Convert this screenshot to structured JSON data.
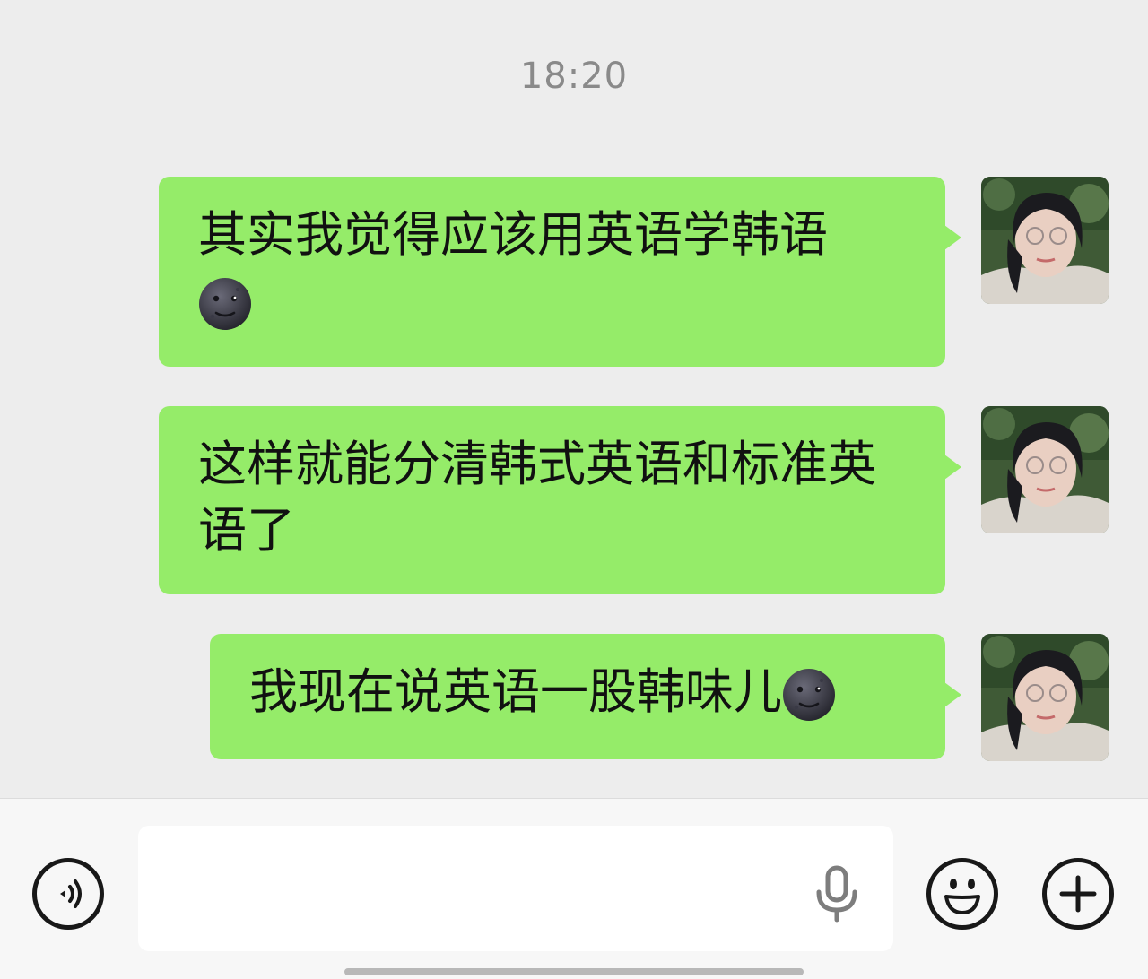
{
  "chat": {
    "timestamp": "18:20",
    "messages": [
      {
        "text": "其实我觉得应该用英语学韩语",
        "emoji": "new-moon-face-emoji",
        "emoji_position": "new-line"
      },
      {
        "text": "这样就能分清韩式英语和标准英语了",
        "emoji": "",
        "emoji_position": ""
      },
      {
        "text": "我现在说英语一股韩味儿",
        "emoji": "new-moon-face-emoji",
        "emoji_position": "inline-end"
      }
    ]
  },
  "input_bar": {
    "voice_icon": "voice-mode-icon",
    "mic_icon": "microphone-icon",
    "emoji_icon": "smiley-face-icon",
    "plus_icon": "plus-icon",
    "text_value": ""
  },
  "colors": {
    "background": "#ededed",
    "bubble_green": "#95ec69",
    "timestamp_gray": "#8a8a8a",
    "input_bar": "#f7f7f7"
  }
}
